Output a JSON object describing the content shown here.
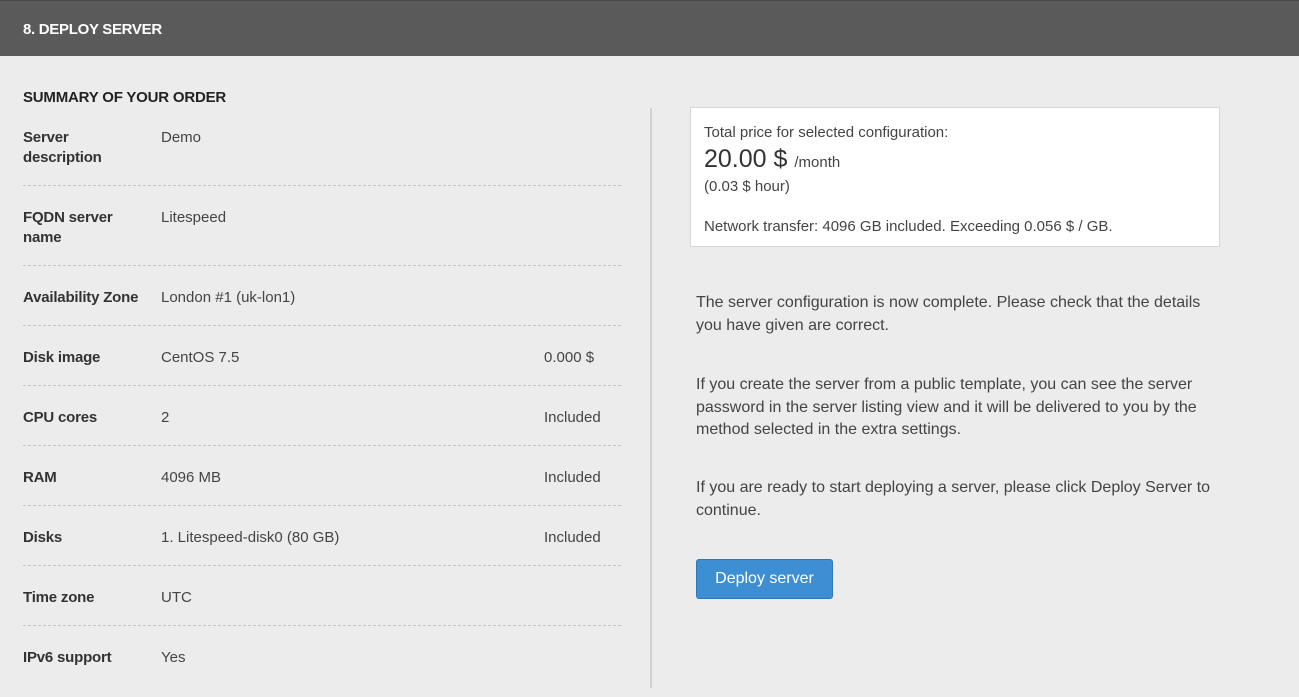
{
  "header": {
    "title": "8. DEPLOY SERVER"
  },
  "summary": {
    "heading": "SUMMARY OF YOUR ORDER",
    "rows": [
      {
        "label": "Server description",
        "value": "Demo",
        "price": ""
      },
      {
        "label": "FQDN server name",
        "value": "Litespeed",
        "price": ""
      },
      {
        "label": "Availability Zone",
        "value": "London #1 (uk-lon1)",
        "price": ""
      },
      {
        "label": "Disk image",
        "value": "CentOS 7.5",
        "price": "0.000 $"
      },
      {
        "label": "CPU cores",
        "value": "2",
        "price": "Included"
      },
      {
        "label": "RAM",
        "value": "4096 MB",
        "price": "Included"
      },
      {
        "label": "Disks",
        "value": "1. Litespeed-disk0 (80 GB)",
        "price": "Included"
      },
      {
        "label": "Time zone",
        "value": "UTC",
        "price": ""
      },
      {
        "label": "IPv6 support",
        "value": "Yes",
        "price": ""
      }
    ]
  },
  "pricing": {
    "label": "Total price for selected configuration:",
    "amount": "20.00 $",
    "period": "/month",
    "hourly": "(0.03 $ hour)",
    "network": "Network transfer: 4096 GB included. Exceeding 0.056 $ / GB."
  },
  "info": {
    "p1": "The server configuration is now complete. Please check that the details you have given are correct.",
    "p2": "If you create the server from a public template, you can see the server password in the server listing view and it will be delivered to you by the method selected in the extra settings.",
    "p3": "If you are ready to start deploying a server, please click Deploy Server to continue."
  },
  "actions": {
    "deploy_label": "Deploy server"
  },
  "colors": {
    "header_bg": "#5a5a5a",
    "page_bg": "#ececec",
    "button_bg": "#3d8ed3"
  }
}
